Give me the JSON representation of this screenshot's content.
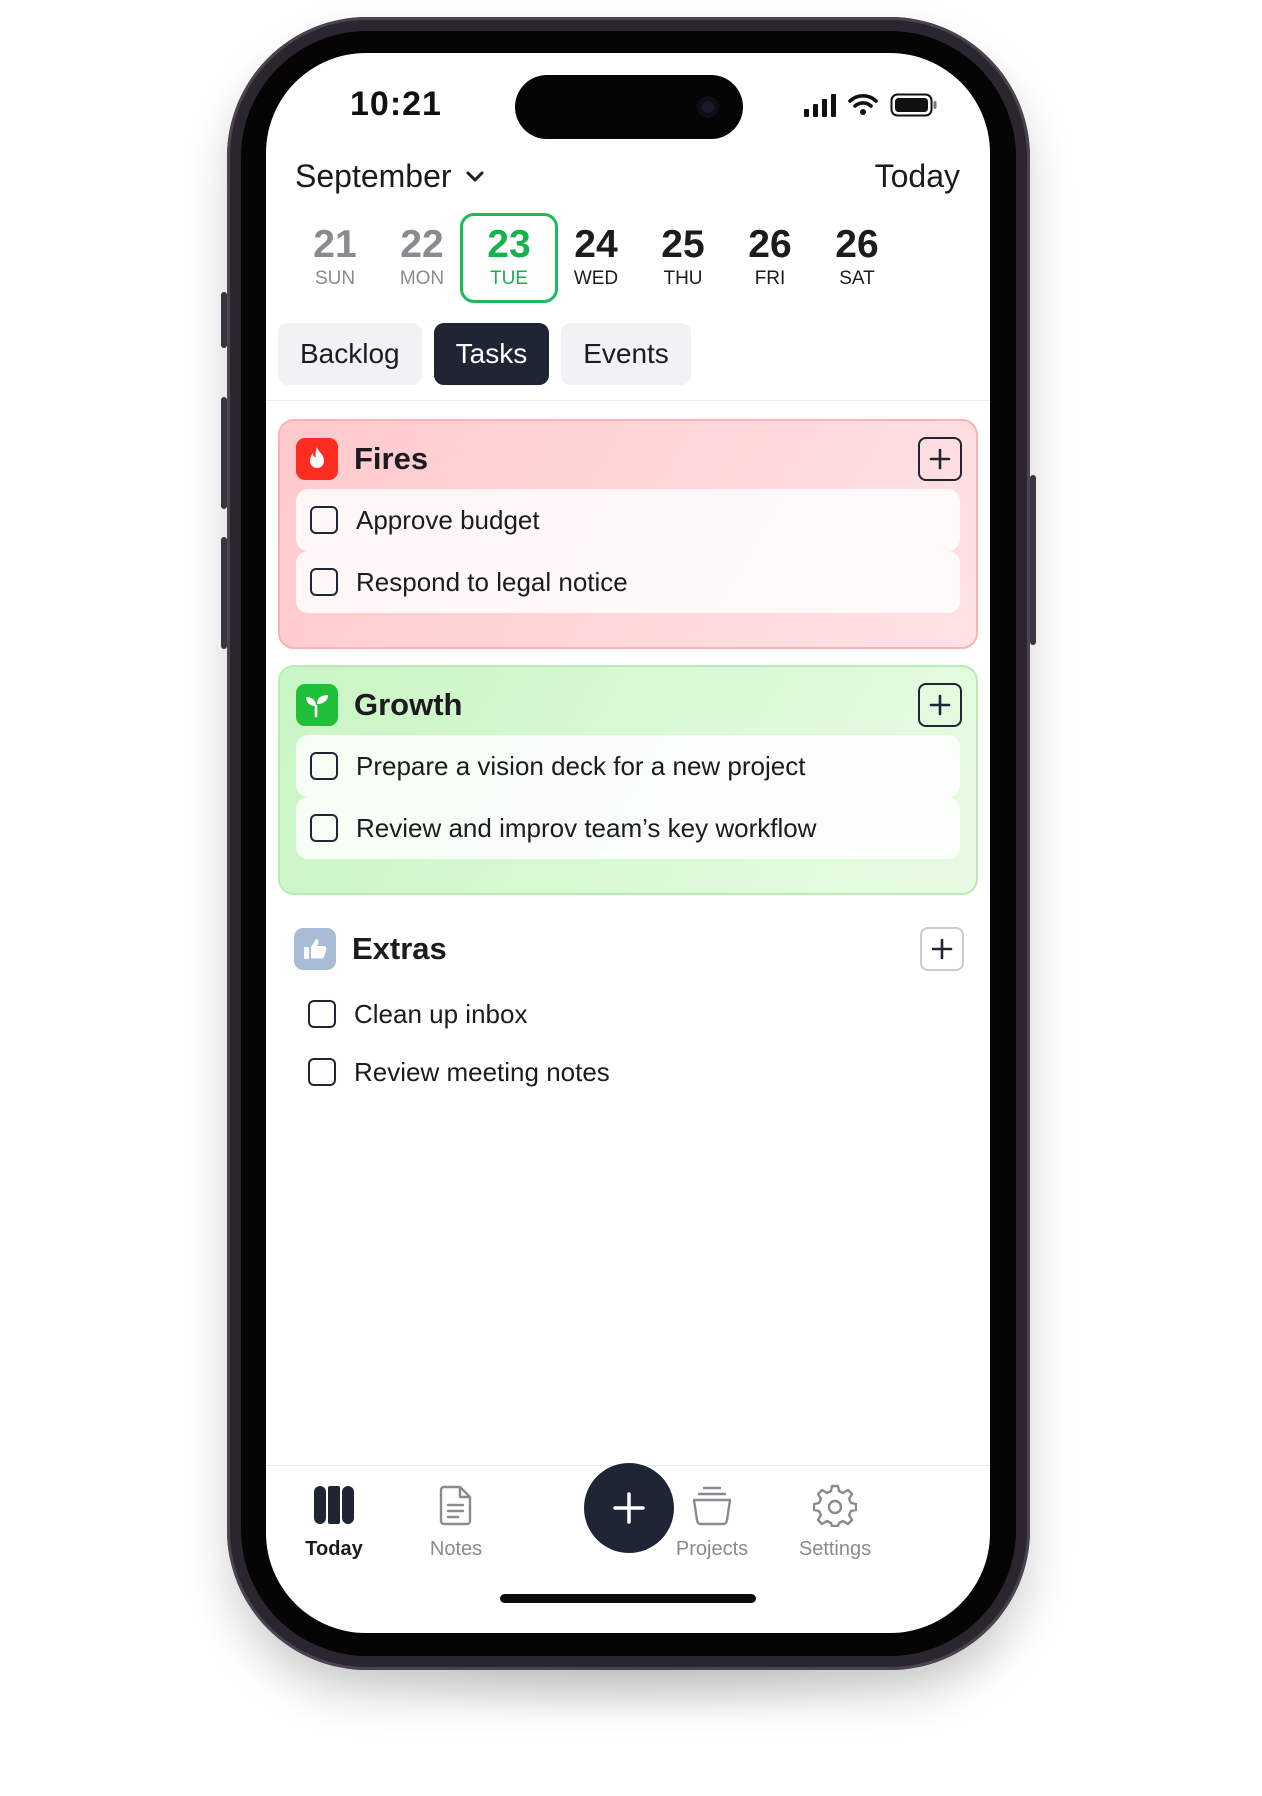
{
  "status_bar": {
    "time": "10:21"
  },
  "header": {
    "month": "September",
    "today_button": "Today"
  },
  "days": [
    {
      "num": "21",
      "dow": "SUN",
      "state": "past"
    },
    {
      "num": "22",
      "dow": "MON",
      "state": "past"
    },
    {
      "num": "23",
      "dow": "TUE",
      "state": "selected"
    },
    {
      "num": "24",
      "dow": "WED",
      "state": "future"
    },
    {
      "num": "25",
      "dow": "THU",
      "state": "future"
    },
    {
      "num": "26",
      "dow": "FRI",
      "state": "future"
    },
    {
      "num": "26",
      "dow": "SAT",
      "state": "future"
    }
  ],
  "tabs": [
    {
      "label": "Backlog",
      "active": false
    },
    {
      "label": "Tasks",
      "active": true
    },
    {
      "label": "Events",
      "active": false
    }
  ],
  "sections": [
    {
      "title": "Fires",
      "icon": "flame-icon",
      "color": "#ff3b30",
      "tasks": [
        "Approve budget",
        "Respond to legal notice"
      ]
    },
    {
      "title": "Growth",
      "icon": "sprout-icon",
      "color": "#1fbf3a",
      "tasks": [
        "Prepare a vision deck for a new project",
        "Review and improv team’s key workflow"
      ]
    },
    {
      "title": "Extras",
      "icon": "thumbs-up-icon",
      "color": "#a9bcd6",
      "tasks": [
        "Clean up inbox",
        "Review meeting notes"
      ]
    }
  ],
  "bottom_nav": [
    {
      "label": "Today",
      "icon": "columns-icon",
      "active": true
    },
    {
      "label": "Notes",
      "icon": "note-icon",
      "active": false
    },
    {
      "label": "Projects",
      "icon": "stack-icon",
      "active": false
    },
    {
      "label": "Settings",
      "icon": "gear-icon",
      "active": false
    }
  ],
  "colors": {
    "accent": "#16b24e",
    "dark": "#1f2535",
    "fires_bg": "#ffd6d9",
    "growth_bg": "#d6f8d1"
  }
}
